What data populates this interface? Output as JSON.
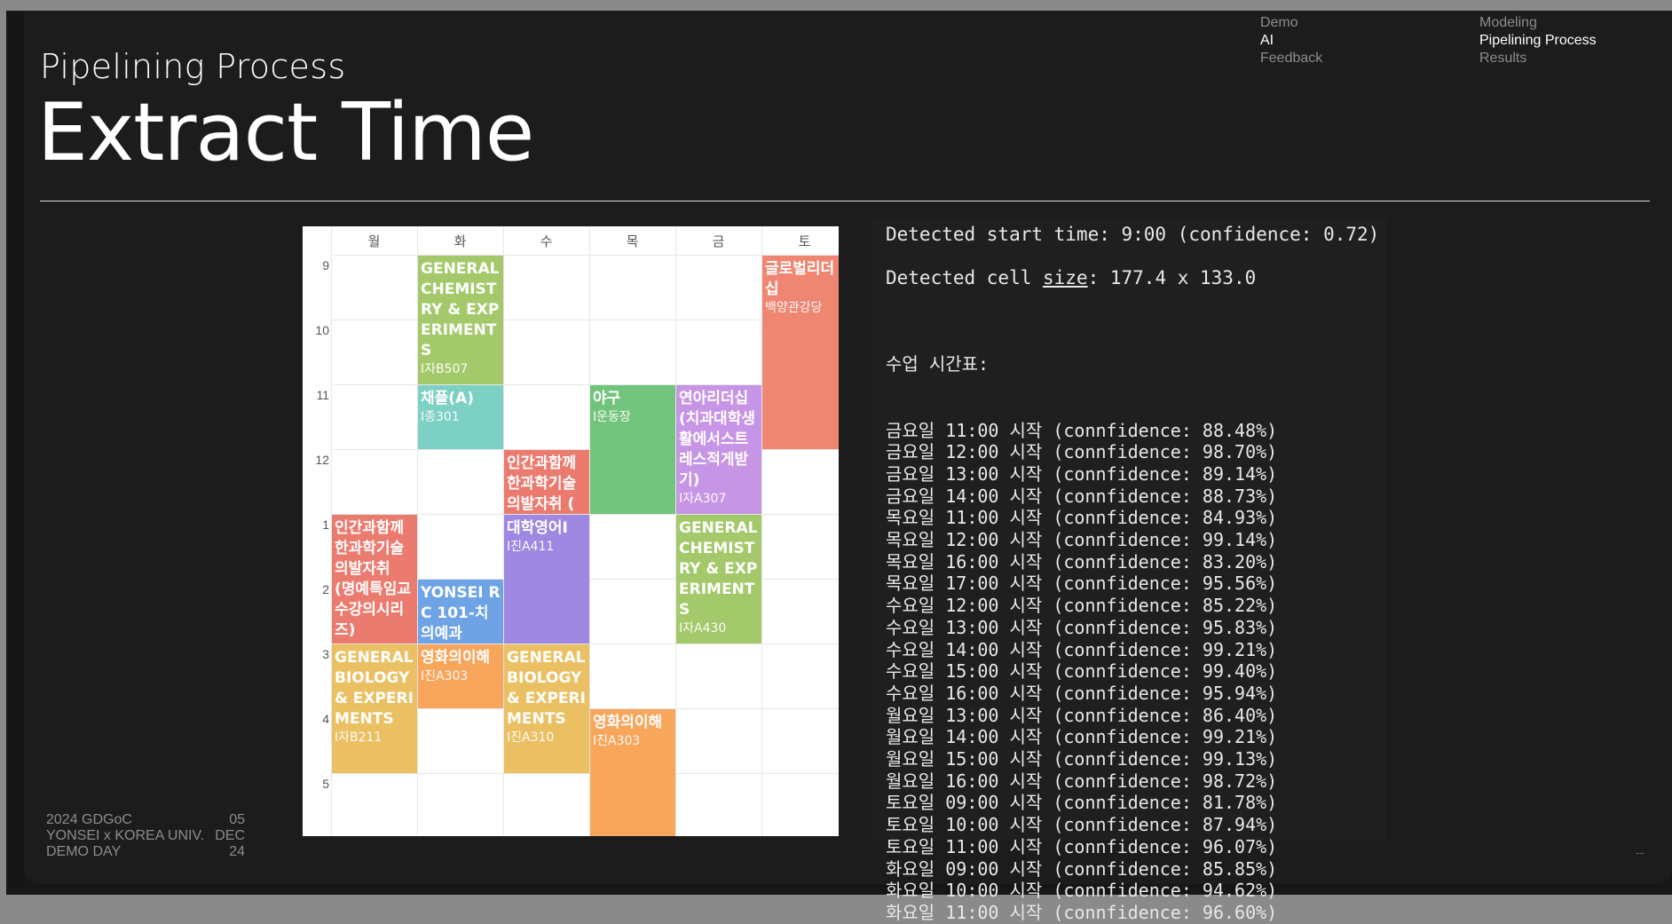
{
  "header": {
    "section_title": "Pipelining Process",
    "main_title": "Extract Time"
  },
  "nav": {
    "left": [
      {
        "label": "Demo",
        "active": false
      },
      {
        "label": "AI",
        "active": true
      },
      {
        "label": "Feedback",
        "active": false
      }
    ],
    "right": [
      {
        "label": "Modeling",
        "active": false
      },
      {
        "label": "Pipelining Process",
        "active": true
      },
      {
        "label": "Results",
        "active": false
      }
    ]
  },
  "footer": {
    "event_line1": "2024 GDGoC",
    "event_line2": "YONSEI x KOREA UNIV.",
    "event_line3": "DEMO DAY",
    "date_day": "05",
    "date_month": "DEC",
    "date_year": "24",
    "page_marker": "--"
  },
  "timetable": {
    "days": [
      "월",
      "화",
      "수",
      "목",
      "금",
      "토"
    ],
    "hours": [
      "9",
      "10",
      "11",
      "12",
      "1",
      "2",
      "3",
      "4",
      "5"
    ],
    "events": [
      {
        "day": 1,
        "start": 0,
        "duration": 2,
        "title": "GENERAL CHEMISTRY & EXPERIMENTS",
        "room": "I자B507",
        "color": "#a3c96a"
      },
      {
        "day": 1,
        "start": 2,
        "duration": 1,
        "title": "채플(A)",
        "room": "I종301",
        "color": "#7dd0c4"
      },
      {
        "day": 5,
        "start": 0,
        "duration": 3,
        "title": "글로벌리더십",
        "room": "백양관강당",
        "color": "#ef8672"
      },
      {
        "day": 3,
        "start": 2,
        "duration": 2,
        "title": "야구",
        "room": "I운동장",
        "color": "#72c47d"
      },
      {
        "day": 4,
        "start": 2,
        "duration": 2,
        "title": "연아리더십(치과대학생활에서스트레스적게받기)",
        "room": "I자A307",
        "color": "#c795e6"
      },
      {
        "day": 2,
        "start": 3,
        "duration": 1,
        "title": "인간과함께한과학기술의발자취 (",
        "room": "",
        "color": "#ec7b6f"
      },
      {
        "day": 0,
        "start": 4,
        "duration": 2,
        "title": "인간과함께한과학기술의발자취 (명예특임교수강의시리즈)",
        "room": "",
        "color": "#ec7b6f"
      },
      {
        "day": 2,
        "start": 4,
        "duration": 2,
        "title": "대학영어I",
        "room": "I진A411",
        "color": "#9e88e2"
      },
      {
        "day": 4,
        "start": 4,
        "duration": 2,
        "title": "GENERAL CHEMISTRY & EXPERIMENTS",
        "room": "I자A430",
        "color": "#a3c96a"
      },
      {
        "day": 1,
        "start": 5,
        "duration": 1,
        "title": "YONSEI RC 101-치의예과",
        "room": "",
        "color": "#6ea4e6"
      },
      {
        "day": 0,
        "start": 6,
        "duration": 2,
        "title": "GENERAL BIOLOGY & EXPERIMENTS",
        "room": "I자B211",
        "color": "#ebc063"
      },
      {
        "day": 1,
        "start": 6,
        "duration": 1,
        "title": "영화의이해",
        "room": "I진A303",
        "color": "#f8a65c"
      },
      {
        "day": 2,
        "start": 6,
        "duration": 2,
        "title": "GENERAL BIOLOGY & EXPERIMENTS",
        "room": "I진A310",
        "color": "#ebc063"
      },
      {
        "day": 3,
        "start": 7,
        "duration": 2,
        "title": "영화의이해",
        "room": "I진A303",
        "color": "#f8a65c"
      }
    ]
  },
  "console": {
    "start_time_line": "Detected start time: 9:00 (confidence: 0.72)",
    "cell_prefix": "Detected cell ",
    "cell_word": "size",
    "cell_suffix": ": 177.4 x 133.0",
    "schedule_header": "수업 시간표:",
    "schedule": [
      "금요일 11:00 시작 (connfidence: 88.48%)",
      "금요일 12:00 시작 (connfidence: 98.70%)",
      "금요일 13:00 시작 (connfidence: 89.14%)",
      "금요일 14:00 시작 (connfidence: 88.73%)",
      "목요일 11:00 시작 (connfidence: 84.93%)",
      "목요일 12:00 시작 (connfidence: 99.14%)",
      "목요일 16:00 시작 (connfidence: 83.20%)",
      "목요일 17:00 시작 (connfidence: 95.56%)",
      "수요일 12:00 시작 (connfidence: 85.22%)",
      "수요일 13:00 시작 (connfidence: 95.83%)",
      "수요일 14:00 시작 (connfidence: 99.21%)",
      "수요일 15:00 시작 (connfidence: 99.40%)",
      "수요일 16:00 시작 (connfidence: 95.94%)",
      "월요일 13:00 시작 (connfidence: 86.40%)",
      "월요일 14:00 시작 (connfidence: 99.21%)",
      "월요일 15:00 시작 (connfidence: 99.13%)",
      "월요일 16:00 시작 (connfidence: 98.72%)",
      "토요일 09:00 시작 (connfidence: 81.78%)",
      "토요일 10:00 시작 (connfidence: 87.94%)",
      "토요일 11:00 시작 (connfidence: 96.07%)",
      "화요일 09:00 시작 (connfidence: 85.85%)",
      "화요일 10:00 시작 (connfidence: 94.62%)",
      "화요일 11:00 시작 (connfidence: 96.60%)"
    ]
  }
}
